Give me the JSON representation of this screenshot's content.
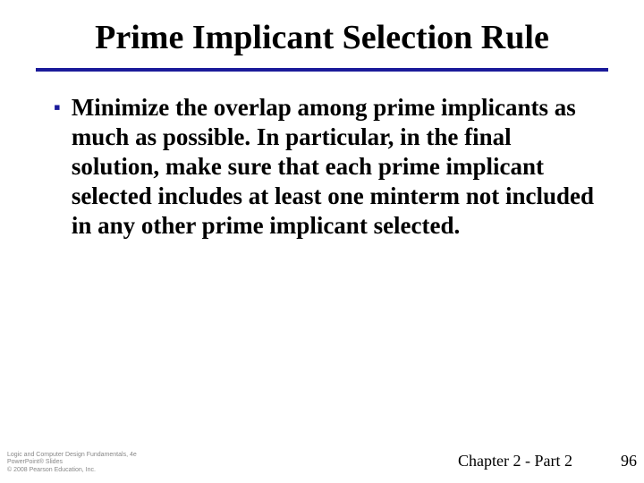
{
  "slide": {
    "title": "Prime Implicant Selection Rule",
    "bullets": [
      "Minimize the overlap among prime implicants as much as possible. In particular, in the final solution, make sure that each prime implicant selected includes at least one minterm not included in any other prime implicant selected."
    ]
  },
  "footer": {
    "attribution_line1": "Logic and Computer Design Fundamentals, 4e",
    "attribution_line2": "PowerPoint® Slides",
    "attribution_line3": "© 2008 Pearson Education, Inc.",
    "chapter": "Chapter 2 - Part 2",
    "page_number": "96"
  }
}
